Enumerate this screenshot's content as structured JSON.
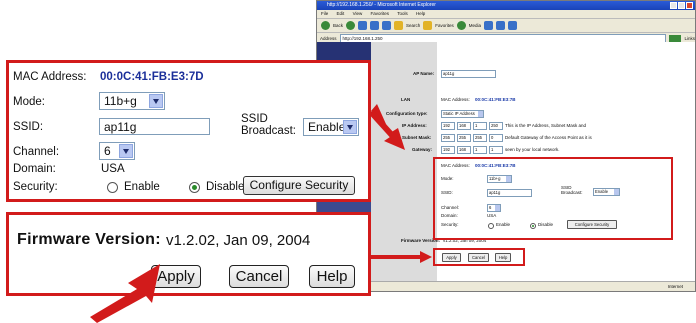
{
  "browser": {
    "title": "http://192.168.1.250/ - Microsoft Internet Explorer",
    "menu": [
      "File",
      "Edit",
      "View",
      "Favorites",
      "Tools",
      "Help"
    ],
    "toolbar": {
      "back": "Back",
      "search": "Search",
      "favorites": "Favorites",
      "media": "Media"
    },
    "address_label": "Address",
    "address_value": "http://192.168.1.250",
    "links_label": "Links",
    "status_zone": "Internet"
  },
  "page": {
    "ap_name_label": "AP Name:",
    "ap_name_value": "ap11g",
    "lan_label": "LAN",
    "lan_mac_label": "MAC Address:",
    "lan_mac_value": "00:0C:41:FB:E3:7B",
    "config_type_label": "Configuration type:",
    "config_type_value": "Static IP Address",
    "ip_label": "IP Address:",
    "ip_octets": [
      "192",
      "168",
      "1",
      "250"
    ],
    "ip_note": "This is the IP Address, Subnet Mask and",
    "mask_label": "Subnet Mask:",
    "mask_octets": [
      "255",
      "255",
      "255",
      "0"
    ],
    "mask_note": "Default Gateway of the Access Point as it is",
    "gw_label": "Gateway:",
    "gw_octets": [
      "192",
      "168",
      "1",
      "1"
    ],
    "gw_note": "seen by your local network.",
    "wl_mac_label": "MAC Address:",
    "wl_mac_value": "00:0C:41:FB:E3:7B",
    "mode_label": "Mode:",
    "mode_value": "11b+g",
    "ssid_label": "SSID:",
    "ssid_value": "ap11g",
    "ssid_bcast_label1": "SSID",
    "ssid_bcast_label2": "Broadcast:",
    "ssid_bcast_value": "Enable",
    "channel_label": "Channel:",
    "channel_value": "6",
    "domain_label": "Domain:",
    "domain_value": "USA",
    "security_label": "Security:",
    "enable_label": "Enable",
    "disable_label": "Disable",
    "config_security_label": "Configure Security",
    "fw_label": "Firmware Version:",
    "fw_value": "v1.2.02, Jan 09, 2004",
    "apply_label": "Apply",
    "cancel_label": "Cancel",
    "help_label": "Help"
  },
  "zoom_wireless": {
    "mac_label": "MAC Address:",
    "mac_value": "00:0C:41:FB:E3:7D",
    "mode_label": "Mode:",
    "mode_value": "11b+g",
    "ssid_label": "SSID:",
    "ssid_value": "ap11g",
    "ssid_bcast_label1": "SSID",
    "ssid_bcast_label2": "Broadcast:",
    "ssid_bcast_value": "Enable",
    "channel_label": "Channel:",
    "channel_value": "6",
    "domain_label": "Domain:",
    "domain_value": "USA",
    "security_label": "Security:",
    "enable_label": "Enable",
    "disable_label": "Disable",
    "config_security_label": "Configure Security"
  },
  "zoom_firmware": {
    "fw_label": "Firmware Version:",
    "fw_value": "v1.2.02, Jan 09, 2004",
    "apply_label": "Apply",
    "cancel_label": "Cancel",
    "help_label": "Help"
  },
  "colors": {
    "highlight": "#d21b1b",
    "mac_text": "#1b2f9a",
    "nav_blue": "#3b4a8f"
  }
}
